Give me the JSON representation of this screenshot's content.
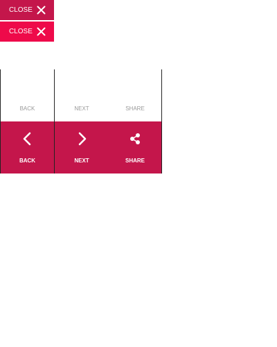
{
  "close_buttons": [
    {
      "label": "CLOSE",
      "color": "#c4164b",
      "icon": "close-icon"
    },
    {
      "label": "CLOSE",
      "color": "#ee0a4a",
      "icon": "close-icon"
    }
  ],
  "nav": {
    "top_row": {
      "back": "BACK",
      "next": "NEXT",
      "share": "SHARE"
    },
    "bottom_row": {
      "back": "BACK",
      "next": "NEXT",
      "share": "SHARE",
      "background": "#c4164b",
      "icons": [
        "chevron-left-icon",
        "chevron-right-icon",
        "share-icon"
      ]
    }
  }
}
